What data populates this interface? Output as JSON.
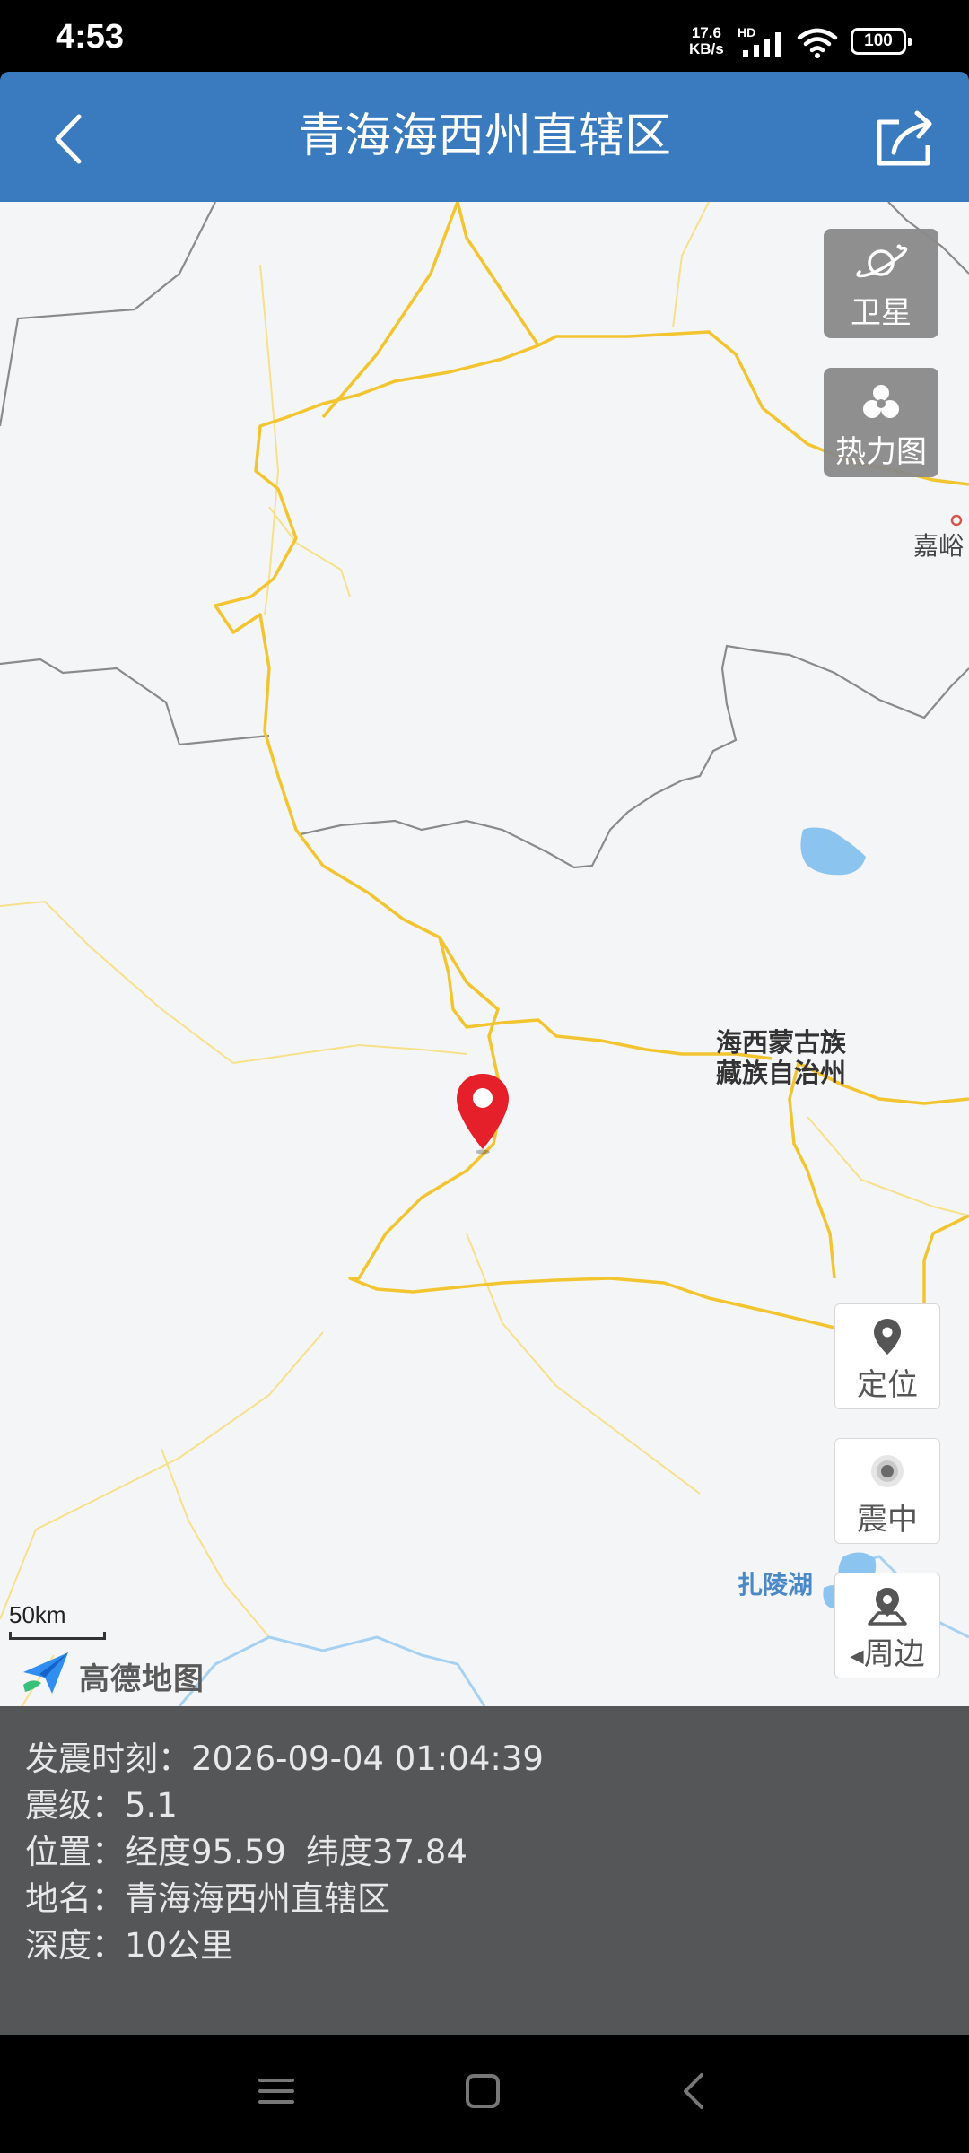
{
  "status_bar": {
    "time": "4:53",
    "net_speed_value": "17.6",
    "net_speed_unit": "KB/s",
    "hd": "HD",
    "battery": "100"
  },
  "header": {
    "title": "青海海西州直辖区"
  },
  "map": {
    "region_label_line1": "海西蒙古族",
    "region_label_line2": "藏族自治州",
    "lake_label": "扎陵湖",
    "city_label": "嘉峪",
    "scale": "50km",
    "provider": "高德地图",
    "layer_toggles": [
      {
        "label": "卫星",
        "icon": "satellite-icon"
      },
      {
        "label": "热力图",
        "icon": "heatmap-icon"
      }
    ],
    "controls": [
      {
        "label": "定位",
        "icon": "location-pin-icon"
      },
      {
        "label": "震中",
        "icon": "epicenter-icon"
      },
      {
        "label": "周边",
        "icon": "nearby-icon"
      }
    ]
  },
  "info": {
    "time_label": "发震时刻：",
    "time_value": "2026-09-04 01:04:39",
    "magnitude_label": "震级：",
    "magnitude_value": "5.1",
    "position_label": "位置：",
    "position_lon": "经度95.59",
    "position_lat": "纬度37.84",
    "place_label": "地名：",
    "place_value": "青海海西州直辖区",
    "depth_label": "深度：",
    "depth_value": "10公里"
  },
  "colors": {
    "header": "#3a7bbf",
    "road": "#f2c530",
    "border": "#8a8a8a",
    "pin": "#e5202a",
    "water": "#8cc4f0",
    "info_bg": "#555658"
  }
}
